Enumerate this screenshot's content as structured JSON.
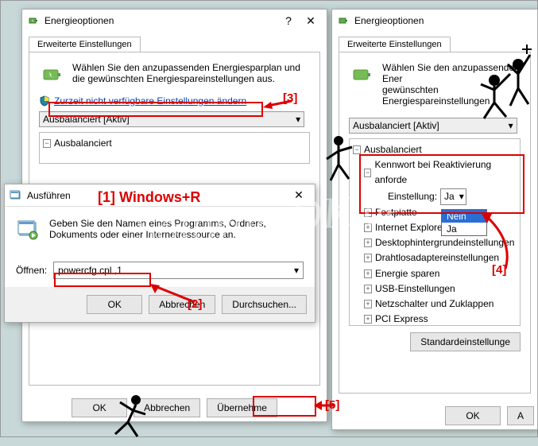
{
  "watermark": "SoftwareOK.de",
  "annotations": {
    "a1": "[1] Windows+R",
    "a2": "[2]",
    "a3": "[3]",
    "a4": "[4]",
    "a5": "[5]"
  },
  "window1": {
    "title": "Energieoptionen",
    "tab": "Erweiterte Einstellungen",
    "intro": "Wählen Sie den anzupassenden Energiesparplan und die gewünschten Energiespareinstellungen aus.",
    "link": "Zurzeit nicht verfügbare Einstellungen ändern",
    "plan": "Ausbalanciert [Aktiv]",
    "tree_root": "Ausbalanciert",
    "buttons": {
      "ok": "OK",
      "cancel": "Abbrechen",
      "apply": "Übernehme"
    }
  },
  "window2": {
    "title": "Energieoptionen",
    "tab": "Erweiterte Einstellungen",
    "intro": "Wählen Sie den anzupassenden Energiesparplan und die gewünschten Energiespareinstellungen aus.",
    "plan": "Ausbalanciert [Aktiv]",
    "tree": {
      "root": "Ausbalanciert",
      "item1": "Kennwort bei Reaktivierung anforde",
      "item1_setting_label": "Einstellung:",
      "item1_setting_value": "Ja",
      "dropdown": {
        "opt1": "Nein",
        "opt2": "Ja"
      },
      "item2": "Festplatte",
      "item3": "Internet Explorer",
      "item4": "Desktophintergrundeinstellungen",
      "item5": "Drahtlosadaptereinstellungen",
      "item6": "Energie sparen",
      "item7": "USB-Einstellungen",
      "item8": "Netzschalter und Zuklappen",
      "item9": "PCI Express"
    },
    "restore": "Standardeinstellunge",
    "buttons": {
      "ok": "OK",
      "cancel": "A"
    }
  },
  "run": {
    "title": "Ausführen",
    "text": "Geben Sie den Namen eines Programms, Ordners, Dokuments oder einer Internetressource an.",
    "label": "Öffnen:",
    "value": "powercfg.cpl ,1",
    "buttons": {
      "ok": "OK",
      "cancel": "Abbrechen",
      "browse": "Durchsuchen..."
    }
  }
}
